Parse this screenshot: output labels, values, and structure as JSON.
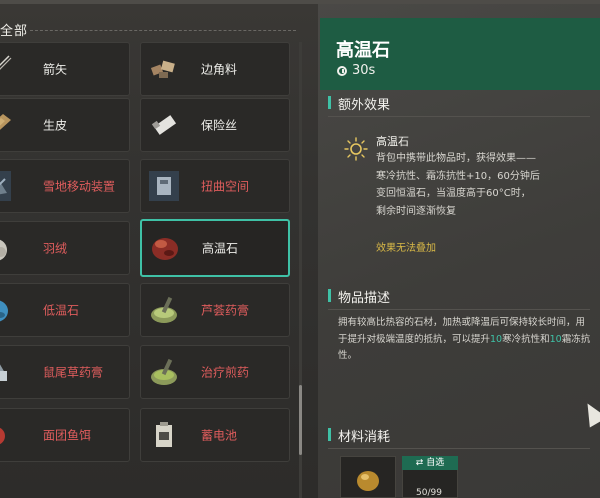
{
  "category": {
    "title": "全部"
  },
  "items": [
    {
      "name": "箭矢",
      "color": "white",
      "icon": "arrow-icon"
    },
    {
      "name": "边角料",
      "color": "white",
      "icon": "scrap-icon"
    },
    {
      "name": "生皮",
      "color": "white",
      "icon": "hide-icon"
    },
    {
      "name": "保险丝",
      "color": "white",
      "icon": "fuse-icon"
    },
    {
      "name": "雪地移动装置",
      "color": "red",
      "icon": "snow-device-icon"
    },
    {
      "name": "扭曲空间",
      "color": "red",
      "icon": "warp-space-icon"
    },
    {
      "name": "羽绒",
      "color": "red",
      "icon": "down-feather-icon"
    },
    {
      "name": "高温石",
      "color": "white",
      "icon": "hot-stone-icon",
      "selected": true
    },
    {
      "name": "低温石",
      "color": "red",
      "icon": "cold-stone-icon"
    },
    {
      "name": "芦荟药膏",
      "color": "red",
      "icon": "aloe-ointment-icon"
    },
    {
      "name": "鼠尾草药膏",
      "color": "red",
      "icon": "sage-ointment-icon"
    },
    {
      "name": "治疗煎药",
      "color": "red",
      "icon": "healing-decoction-icon"
    },
    {
      "name": "面团鱼饵",
      "color": "red",
      "icon": "dough-bait-icon"
    },
    {
      "name": "蓄电池",
      "color": "red",
      "icon": "battery-icon"
    }
  ],
  "detail": {
    "title": "高温石",
    "time": "30s",
    "sections": {
      "extra_effect": "额外效果",
      "description": "物品描述",
      "materials": "材料消耗"
    },
    "effect": {
      "name": "高温石",
      "icon": "sun-icon",
      "lines": [
        "背包中携带此物品时，获得效果——",
        "寒冷抗性、霜冻抗性+10，60分钟后",
        "变回恒温石，当温度高于60°C时，",
        "剩余时间逐渐恢复"
      ],
      "warning": "效果无法叠加"
    },
    "description": {
      "part1": "拥有较高比热容的石材，加热或降温后可保持较长时间，用于提升对极端温度的抵抗，可以提升",
      "num1": "10",
      "part2": "寒冷抗性和",
      "num2": "10",
      "part3": "霜冻抗性。"
    },
    "materials": {
      "auto_label": "自选",
      "qty_partial": "50/99"
    }
  },
  "colors": {
    "accent": "#3fc1a6",
    "title_bar": "#1e5c43",
    "red_text": "#e05d5d",
    "warning": "#d8b847"
  }
}
